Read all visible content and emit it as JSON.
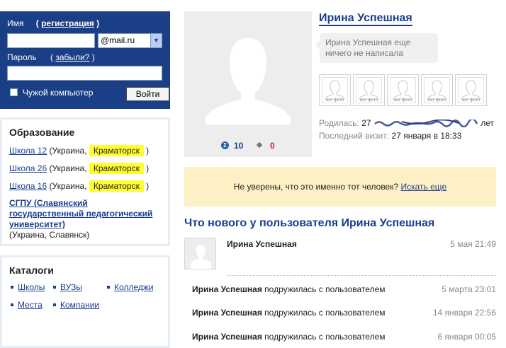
{
  "login": {
    "name_label": "Имя",
    "reg_open": "(",
    "reg_link": "регистрация",
    "reg_close": ")",
    "login_value": "",
    "domain_selected": "@mail.ru",
    "password_label": "Пароль",
    "forgot_open": "(",
    "forgot_link": "забыли?",
    "forgot_close": ")",
    "password_value": "",
    "foreign_pc_label": "Чужой компьютер",
    "submit_label": "Войти"
  },
  "education": {
    "title": "Образование",
    "schools": [
      {
        "name": "Школа 12",
        "country": "(Украина,",
        "city": "Краматорск",
        "close": ")"
      },
      {
        "name": "Школа 26",
        "country": "(Украина,",
        "city": "Краматорск",
        "close": ")"
      },
      {
        "name": "Школа 16",
        "country": "(Украина,",
        "city": "Краматорск",
        "close": ")"
      }
    ],
    "university": {
      "name": "СГПУ (Славянский государственный педагогический университет)",
      "location": "(Украина, Славянск)"
    }
  },
  "catalogs": {
    "title": "Каталоги",
    "items": [
      "Школы",
      "ВУЗы",
      "Колледжи",
      "Места",
      "Компании"
    ]
  },
  "profile": {
    "name": "Ирина Успешная",
    "status": "Ирина Успешная еще ничего не написала",
    "counts": {
      "icon": "sigma-icon",
      "count1": "10",
      "count2": "0"
    },
    "friends_no_photo": [
      "нет фото",
      "нет фото",
      "нет фото",
      "нет фото",
      "нет фото"
    ],
    "born_label": "Родилась:",
    "born_value_prefix": "27",
    "born_value_suffix": "лет",
    "visit_label": "Последний визит:",
    "visit_value": "27 января в 18:33"
  },
  "notice": {
    "text": "Не уверены, что это именно тот человек?",
    "link": "Искать еще"
  },
  "feed": {
    "title": "Что нового у пользователя Ирина Успешная",
    "post": {
      "author": "Ирина Успешная",
      "time": "5 мая 21:49"
    },
    "events": [
      {
        "who": "Ирина Успешная",
        "action": "подружилась с пользователем",
        "time": "5 марта 23:01"
      },
      {
        "who": "Ирина Успешная",
        "action": "подружилась с пользователем",
        "time": "14 января 22:56"
      },
      {
        "who": "Ирина Успешная",
        "action": "подружилась с пользователем",
        "time": "6 января 00:05"
      }
    ]
  },
  "colors": {
    "login_bg": "#1a3f86",
    "link": "#1a3d8f",
    "highlight": "#ffff33",
    "notice_bg": "#fdf0c4"
  }
}
